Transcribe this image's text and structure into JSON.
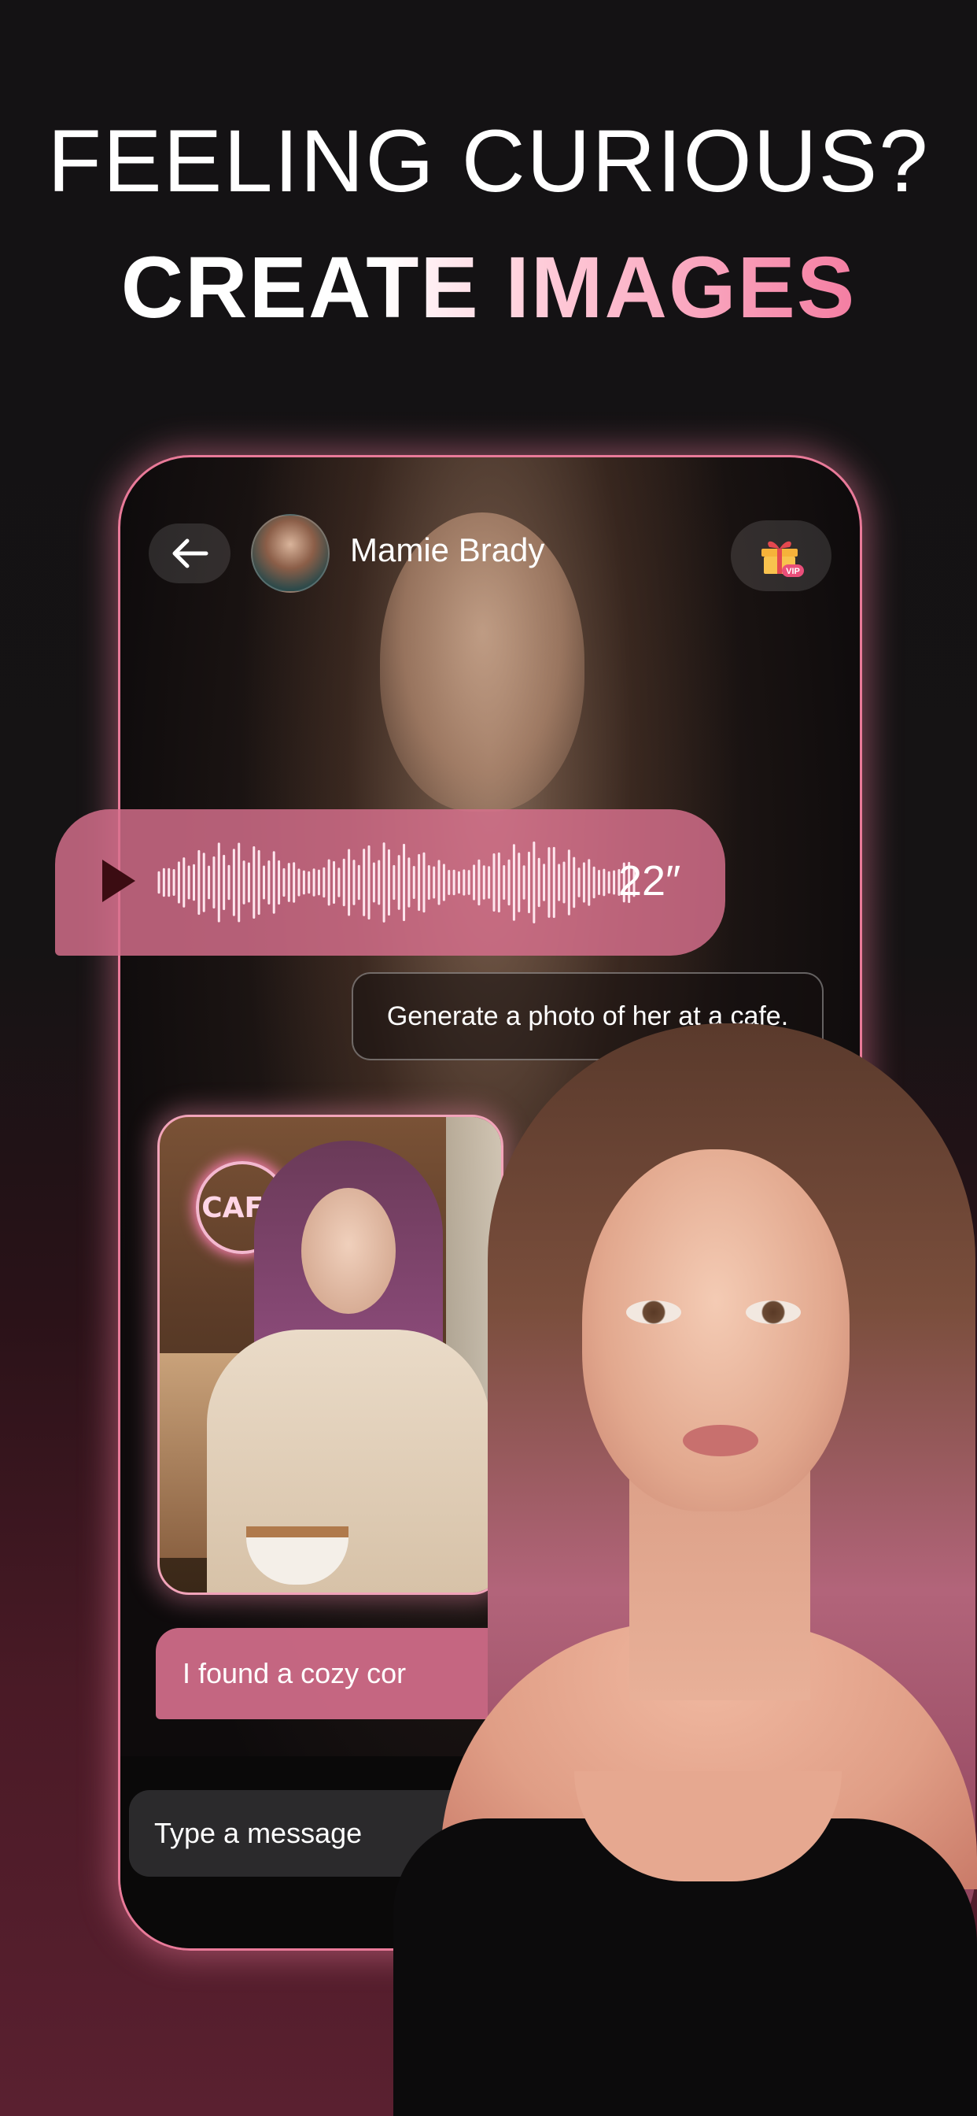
{
  "headline": {
    "line1": "FEELING CURIOUS?",
    "line2": "CREATE IMAGES"
  },
  "chat": {
    "contact_name": "Mamie Brady",
    "back_icon": "arrow-left-icon",
    "gift_icon": "vip-gift-icon",
    "vip_label": "VIP",
    "voice_message": {
      "duration": "22″",
      "play_icon": "play-icon"
    },
    "user_prompt": "Generate a photo of her at a cafe.",
    "generated_image": {
      "sign_text": "CAFÉ"
    },
    "reply_text": "I found a cozy cor",
    "input_placeholder": "Type a message"
  },
  "colors": {
    "accent_pink": "#e97a99",
    "bubble_pink": "#d8708e",
    "background": "#141214"
  }
}
